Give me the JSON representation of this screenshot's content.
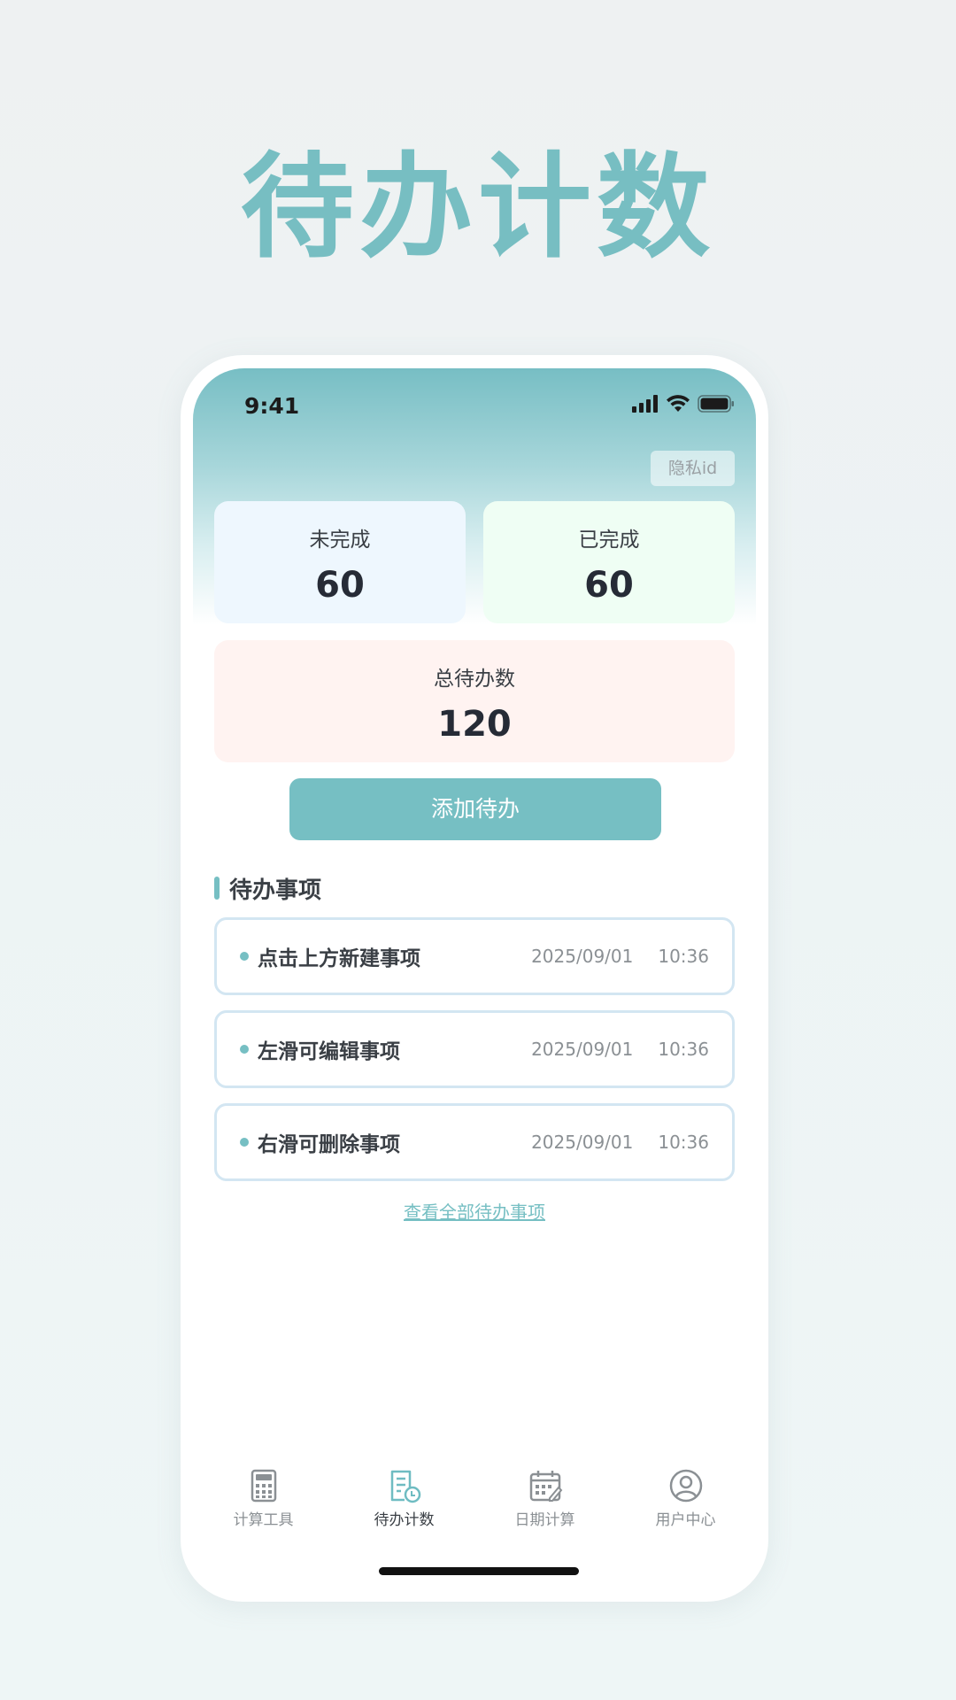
{
  "hero": {
    "title": "待办计数"
  },
  "status_bar": {
    "time": "9:41"
  },
  "privacy_button": "隐私id",
  "stats": {
    "pending": {
      "label": "未完成",
      "value": "60"
    },
    "done": {
      "label": "已完成",
      "value": "60"
    },
    "total": {
      "label": "总待办数",
      "value": "120"
    }
  },
  "add_button": "添加待办",
  "section": {
    "title": "待办事项"
  },
  "todos": [
    {
      "text": "点击上方新建事项",
      "date": "2025/09/01",
      "time": "10:36"
    },
    {
      "text": "左滑可编辑事项",
      "date": "2025/09/01",
      "time": "10:36"
    },
    {
      "text": "右滑可删除事项",
      "date": "2025/09/01",
      "time": "10:36"
    }
  ],
  "view_all": "查看全部待办事项",
  "tabs": [
    {
      "label": "计算工具",
      "icon": "calculator-icon",
      "active": false
    },
    {
      "label": "待办计数",
      "icon": "todo-list-icon",
      "active": true
    },
    {
      "label": "日期计算",
      "icon": "calendar-icon",
      "active": false
    },
    {
      "label": "用户中心",
      "icon": "user-icon",
      "active": false
    }
  ],
  "colors": {
    "accent": "#76bfc3",
    "hero_title": "#77bec2"
  }
}
